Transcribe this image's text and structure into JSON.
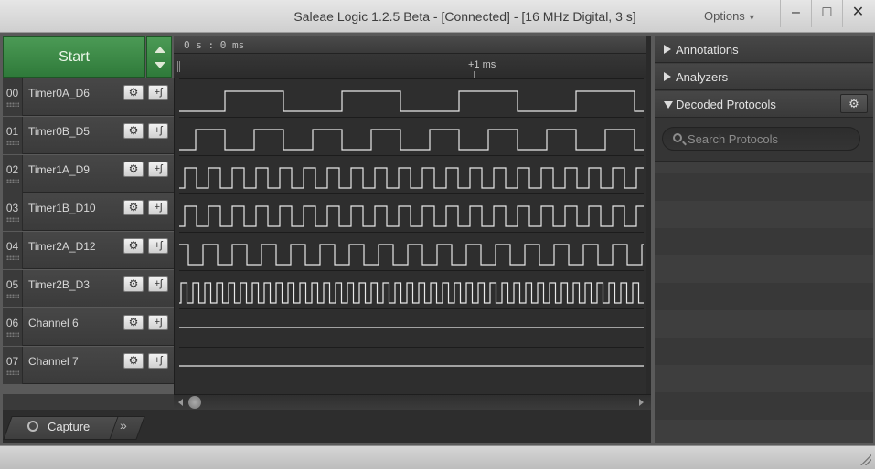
{
  "window": {
    "title": "Saleae Logic 1.2.5 Beta - [Connected] - [16 MHz Digital, 3 s]",
    "options_label": "Options",
    "minimize": "–",
    "maximize": "□",
    "close": "✕"
  },
  "capture": {
    "start_label": "Start"
  },
  "timeline": {
    "origin_label": "0 s : 0 ms",
    "tick_label": "+1 ms"
  },
  "channels": [
    {
      "num": "00",
      "name": "Timer0A_D6",
      "color": "#2b2b2b"
    },
    {
      "num": "01",
      "name": "Timer0B_D5",
      "color": "#8b5a2b"
    },
    {
      "num": "02",
      "name": "Timer1A_D9",
      "color": "#c62828"
    },
    {
      "num": "03",
      "name": "Timer1B_D10",
      "color": "#e08a1e"
    },
    {
      "num": "04",
      "name": "Timer2A_D12",
      "color": "#e6c619"
    },
    {
      "num": "05",
      "name": "Timer2B_D3",
      "color": "#3a9a3a"
    },
    {
      "num": "06",
      "name": "Channel 6",
      "color": "#2952c7"
    },
    {
      "num": "07",
      "name": "Channel 7",
      "color": "#8a3dc2"
    }
  ],
  "channel_buttons": {
    "settings_icon": "gear-icon",
    "trigger_label": "+ʃ"
  },
  "tabs": {
    "capture_label": "Capture",
    "more_label": "»"
  },
  "sidebar": {
    "annotations_label": "Annotations",
    "analyzers_label": "Analyzers",
    "decoded_label": "Decoded Protocols",
    "search_placeholder": "Search Protocols"
  }
}
